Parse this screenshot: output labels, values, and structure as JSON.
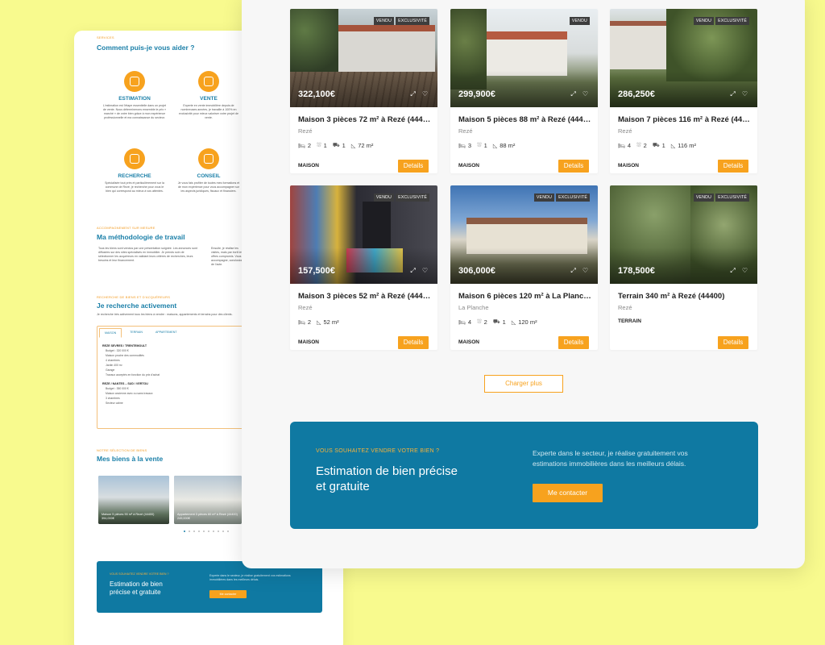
{
  "back_page": {
    "help_eyebrow": "SERVICES",
    "help_title": "Comment puis-je vous aider ?",
    "services": [
      {
        "icon": "estimation-icon",
        "title": "ESTIMATION",
        "desc": "L'estimation est l'étape essentielle dans un projet de vente. Nous déterminerons ensemble le prix « marché » de votre bien grâce à mon expérience professionnelle et ma connaissance du secteur."
      },
      {
        "icon": "sale-icon",
        "title": "VENTE",
        "desc": "Experte en vente immobilière depuis de nombreuses années, je travaille à 100% en exclusivité pour mieux valoriser votre projet de vente."
      },
      {
        "icon": "search-target-icon",
        "title": "RECHERCHE",
        "desc": "Spécialisée tout près et particulièrement sur la commune de Rezé, je recherche pour vous le bien qui correspond au mieux à vos attentes."
      },
      {
        "icon": "advice-icon",
        "title": "CONSEIL",
        "desc": "Je vous fais profiter de toutes mes formations et de mon expérience pour vous accompagner sur les aspects juridiques, fiscaux et financiers."
      }
    ],
    "method_eyebrow": "ACCOMPAGNEMENT SUR MESURE",
    "method_title": "Ma méthodologie de travail",
    "method_left": "Tous les biens sont vendus par une présentation soignée. Les annonces sont diffusées sur des sites spécialisés en immobilier. Je prends soin de sélectionner les acquéreurs en validant leurs critères de recherches, leurs besoins et leur financement.",
    "method_right": "Ensuite, je réalise les visites, mais par écrit les offres compromis. Vous accompagne, conclusion de l'acte.",
    "search_eyebrow": "RECHERCHE DE BIENS ET D'ACQUÉREURS",
    "search_title": "Je recherche activement",
    "search_intro": "Je recherche très activement tous les biens à vendre : maisons, appartements et terrains pour des clients.",
    "tabs": [
      "MAISON",
      "TERRAIN",
      "APPARTEMENT"
    ],
    "search_zone_1": "REZE SEVRES / TRENTEMOULT",
    "search_budget_1": "Budget : 320 000 €",
    "search_items_1": [
      "Maison proche des commodités",
      "4 chambres",
      "Jardin 400 m²",
      "Garage",
      "Travaux acceptés en fonction du prix d'achat"
    ],
    "search_zone_2": "REZE / NANTES – SUD / VERTOU",
    "search_budget_2": "Budget : 350 000 €",
    "search_items_2": [
      "Maison ancienne avec ou sans travaux",
      "3 chambres",
      "Secteur calme"
    ],
    "sale_eyebrow": "NOTRE SÉLECTION DE BIENS",
    "sale_title": "Mes biens à la vente",
    "mini_cards": [
      {
        "title": "Maison 5 pièces 90 m² à Rezé (44400)",
        "price": "394,000€"
      },
      {
        "title": "Appartement 3 pièces 60 m² à Rezé (44400)",
        "price": "249,000€"
      }
    ],
    "cta_eyebrow": "VOUS SOUHAITEZ VENDRE VOTRE BIEN ?",
    "cta_title": "Estimation de bien précise et gratuite",
    "cta_text": "Experte dans le secteur, je réalise gratuitement vos estimations immobilières dans les meilleurs délais.",
    "cta_button": "Me contacter"
  },
  "listings": [
    {
      "badges": [
        "VENDU",
        "EXCLUSIVITÉ"
      ],
      "price": "322,100€",
      "title": "Maison 3 pièces 72 m² à Rezé (44400)",
      "city": "Rezé",
      "bedrooms": "2",
      "bathrooms": "1",
      "garages": "1",
      "area": "72 m²",
      "type": "MAISON"
    },
    {
      "badges": [
        "VENDU"
      ],
      "price": "299,900€",
      "title": "Maison 5 pièces 88 m² à Rezé (44400)",
      "city": "Rezé",
      "bedrooms": "3",
      "bathrooms": "1",
      "garages": "",
      "area": "88 m²",
      "type": "MAISON"
    },
    {
      "badges": [
        "VENDU",
        "EXCLUSIVITÉ"
      ],
      "price": "286,250€",
      "title": "Maison 7 pièces 116 m² à Rezé (44400)",
      "city": "Rezé",
      "bedrooms": "4",
      "bathrooms": "2",
      "garages": "1",
      "area": "116 m²",
      "type": "MAISON"
    },
    {
      "badges": [
        "VENDU",
        "EXCLUSIVITÉ"
      ],
      "price": "157,500€",
      "title": "Maison 3 pièces 52 m² à Rezé (44400)",
      "city": "Rezé",
      "bedrooms": "2",
      "bathrooms": "",
      "garages": "",
      "area": "52 m²",
      "type": "MAISON"
    },
    {
      "badges": [
        "VENDU",
        "EXCLUSIVITÉ"
      ],
      "price": "306,000€",
      "title": "Maison 6 pièces 120 m² à La Planche (44190)",
      "city": "La Planche",
      "bedrooms": "4",
      "bathrooms": "2",
      "garages": "1",
      "area": "120 m²",
      "type": "MAISON"
    },
    {
      "badges": [
        "VENDU",
        "EXCLUSIVITÉ"
      ],
      "price": "178,500€",
      "title": "Terrain 340 m² à Rezé (44400)",
      "city": "Rezé",
      "bedrooms": "",
      "bathrooms": "",
      "garages": "",
      "area": "",
      "type": "TERRAIN"
    }
  ],
  "details_label": "Details",
  "load_more_label": "Charger plus",
  "cta": {
    "eyebrow": "VOUS SOUHAITEZ VENDRE VOTRE BIEN ?",
    "title": "Estimation de bien précise et gratuite",
    "text": "Experte dans le secteur, je réalise gratuitement vos estimations immobilières dans les meilleurs délais.",
    "button": "Me contacter"
  },
  "icons": {
    "expand": "expand-icon",
    "favorite": "heart-icon",
    "bed": "bed-icon",
    "bath": "bath-icon",
    "garage": "car-icon",
    "area": "area-icon"
  },
  "colors": {
    "accent": "#f7a21e",
    "brand": "#0f79a2",
    "background": "#f8fa8e"
  }
}
